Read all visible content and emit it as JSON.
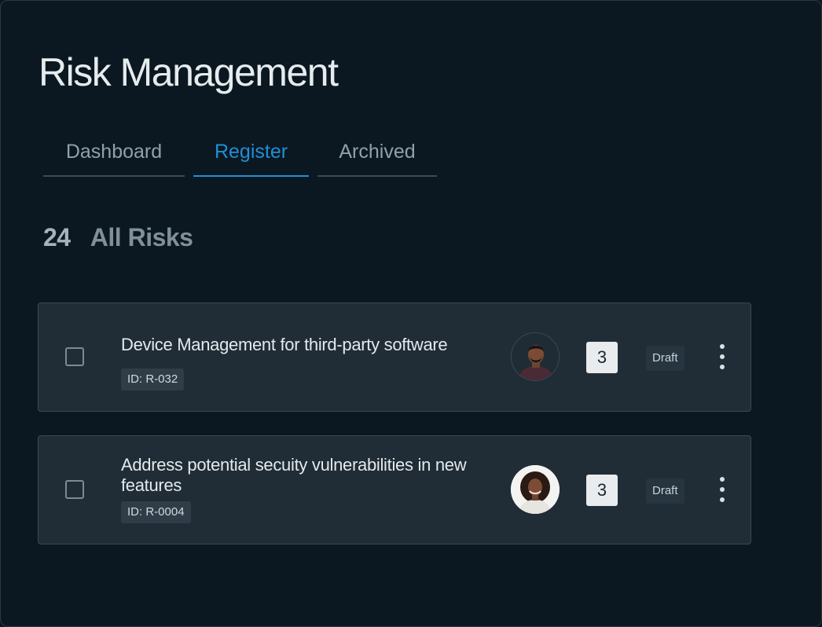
{
  "page": {
    "title": "Risk Management"
  },
  "tabs": [
    {
      "label": "Dashboard",
      "active": false
    },
    {
      "label": "Register",
      "active": true
    },
    {
      "label": "Archived",
      "active": false
    }
  ],
  "summary": {
    "count": "24",
    "label": "All Risks"
  },
  "colors": {
    "accent": "#1e8fd6",
    "background": "#0c1821",
    "card": "#202d37"
  },
  "risks": [
    {
      "title": "Device Management for third-party software",
      "id": "ID: R-032",
      "owner_avatar": "man-avatar",
      "count": "3",
      "status": "Draft",
      "checked": false
    },
    {
      "title": "Address potential secuity vulnerabilities in new features",
      "id": "ID: R-0004",
      "owner_avatar": "woman-avatar",
      "count": "3",
      "status": "Draft",
      "checked": false
    }
  ]
}
